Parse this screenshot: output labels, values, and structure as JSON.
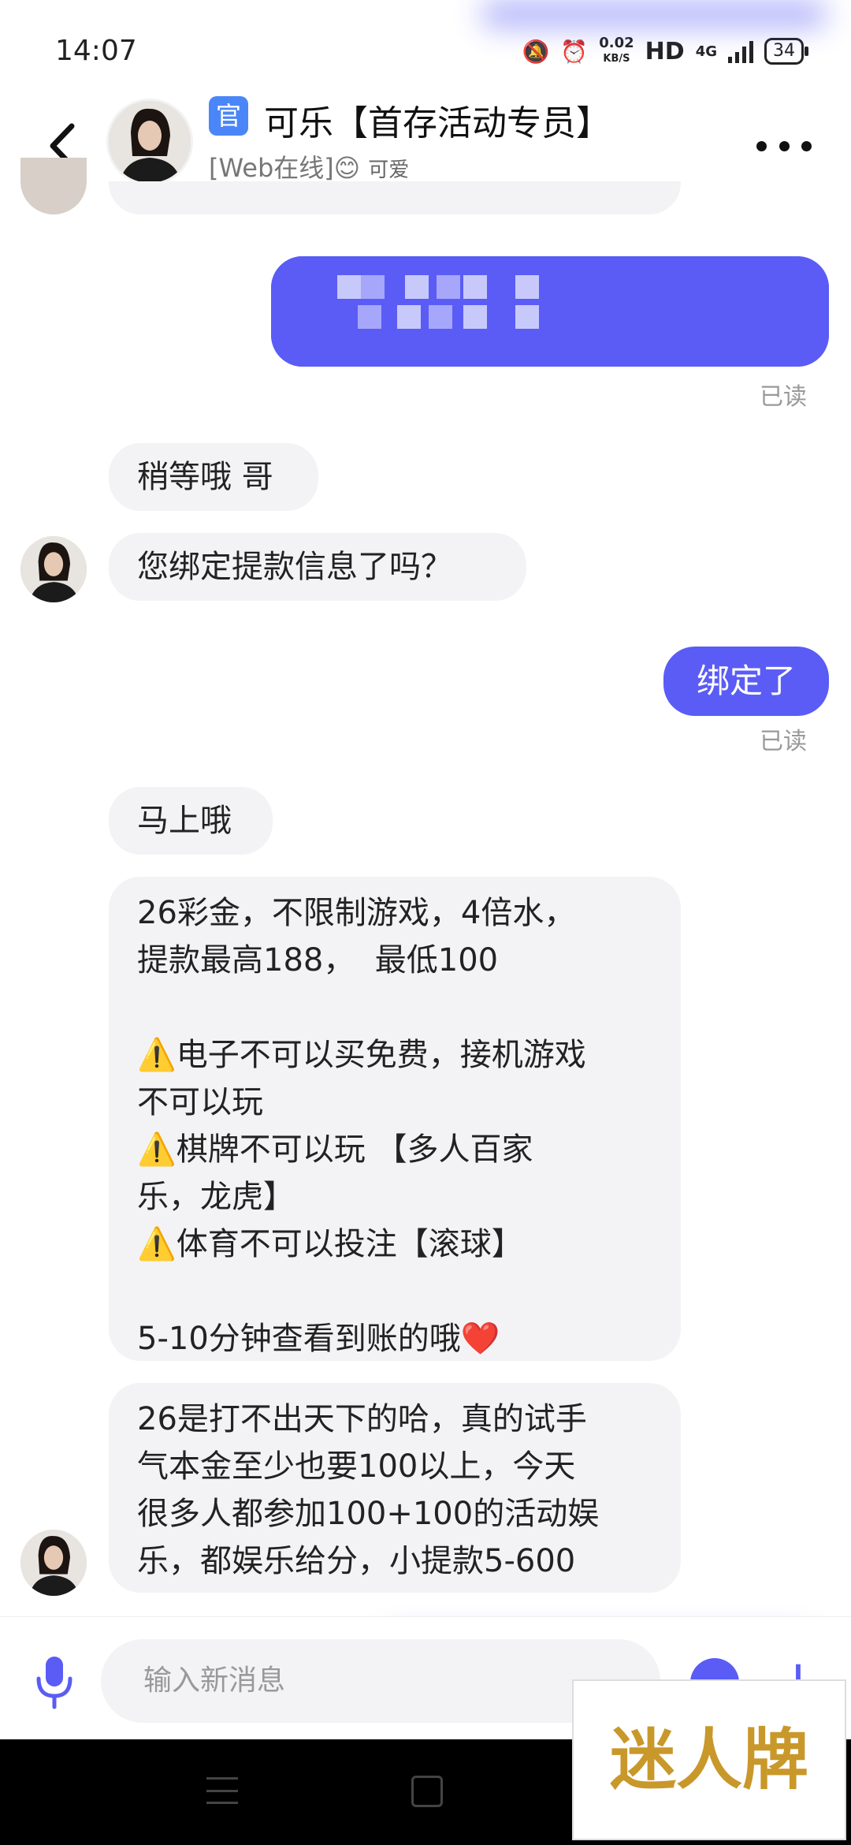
{
  "status_bar": {
    "time": "14:07",
    "net_speed": "0.02",
    "net_unit": "KB/S",
    "hd_label": "HD",
    "network_type": "4G",
    "battery": "34"
  },
  "header": {
    "official_badge": "官",
    "title": "可乐【首存活动专员】",
    "status_text": "[Web在线]",
    "status_emoji": "😊",
    "status_mood": "可爱"
  },
  "messages": [
    {
      "dir": "out",
      "pixelated": true
    },
    {
      "dir": "read",
      "text": "已读"
    },
    {
      "dir": "in",
      "text": "稍等哦 哥"
    },
    {
      "dir": "in",
      "text": "您绑定提款信息了吗？"
    },
    {
      "dir": "out",
      "text": "绑定了"
    },
    {
      "dir": "read",
      "text": "已读"
    },
    {
      "dir": "in",
      "text": "马上哦"
    },
    {
      "dir": "in",
      "lines": [
        "26彩金，不限制游戏，4倍水，",
        "提款最高188，  最低100",
        "",
        "⚠️电子不可以买免费，接机游戏",
        "不可以玩",
        "⚠️棋牌不可以玩 【多人百家",
        "乐，龙虎】",
        "⚠️体育不可以投注【滚球】",
        "",
        "5-10分钟查看到账的哦❤️"
      ]
    },
    {
      "dir": "in",
      "lines": [
        "26是打不出天下的哈，真的试手",
        "气本金至少也要100以上，今天",
        "很多人都参加100+100的活动娱",
        "乐，都娱乐给分，小提款5-600"
      ]
    }
  ],
  "input_bar": {
    "placeholder": "输入新消息"
  },
  "watermark": "迷人牌",
  "colors": {
    "accent": "#5a5cf5",
    "bubble_in": "#f3f3f5",
    "official_badge": "#4a86f7"
  }
}
